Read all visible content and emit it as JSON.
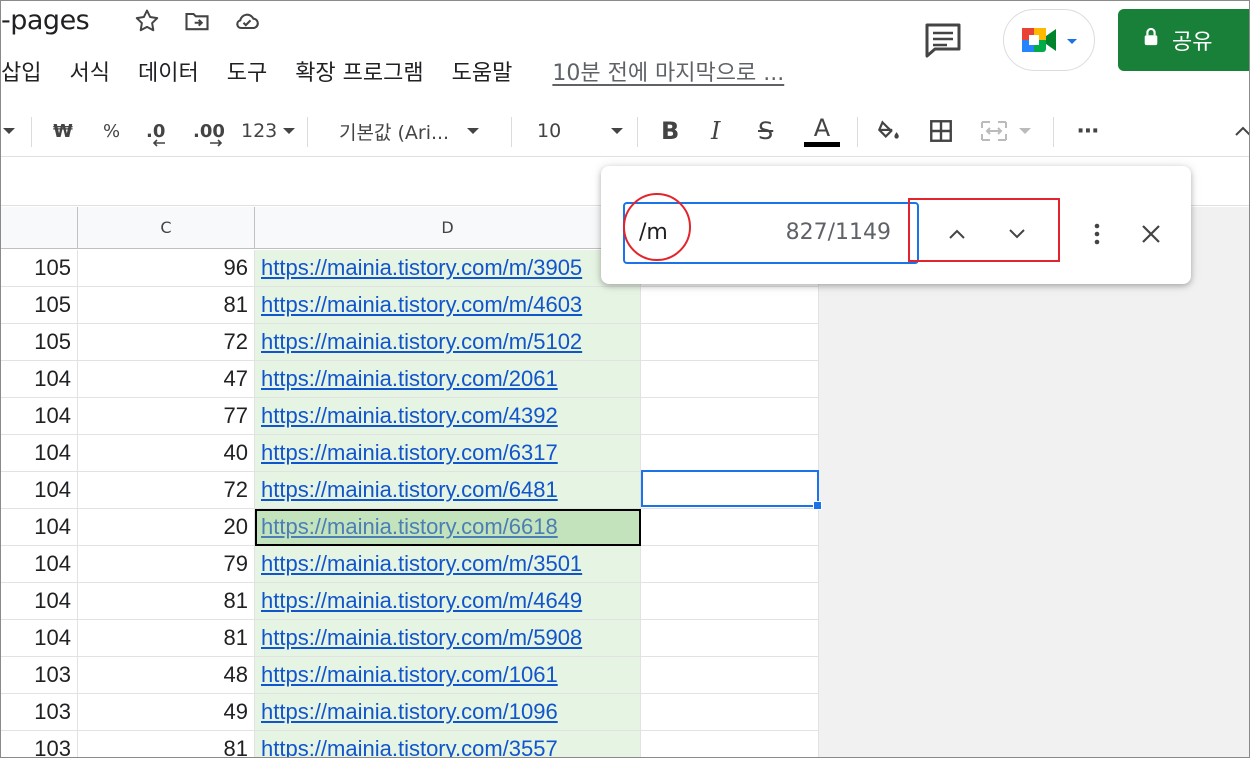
{
  "title": {
    "doc_name": "-pages"
  },
  "menu": {
    "items": [
      "삽입",
      "서식",
      "데이터",
      "도구",
      "확장 프로그램",
      "도움말"
    ],
    "last_edit": "10분 전에 마지막으로 ..."
  },
  "share": {
    "label": "공유"
  },
  "toolbar": {
    "currency": "₩",
    "percent": "%",
    "decrease_decimal": ".0",
    "increase_decimal": ".00",
    "number_format": "123",
    "font": "기본값 (Ari...",
    "font_size": "10",
    "bold": "B",
    "italic": "I",
    "strike": "S",
    "text_color": "A",
    "more": "⋯"
  },
  "columns": {
    "c": "C",
    "d": "D"
  },
  "rows": [
    {
      "b": "105",
      "c": "96",
      "d": "https://mainia.tistory.com/m/3905"
    },
    {
      "b": "105",
      "c": "81",
      "d": "https://mainia.tistory.com/m/4603"
    },
    {
      "b": "105",
      "c": "72",
      "d": "https://mainia.tistory.com/m/5102"
    },
    {
      "b": "104",
      "c": "47",
      "d": "https://mainia.tistory.com/2061"
    },
    {
      "b": "104",
      "c": "77",
      "d": "https://mainia.tistory.com/4392"
    },
    {
      "b": "104",
      "c": "40",
      "d": "https://mainia.tistory.com/6317"
    },
    {
      "b": "104",
      "c": "72",
      "d": "https://mainia.tistory.com/6481"
    },
    {
      "b": "104",
      "c": "20",
      "d": "https://mainia.tistory.com/6618"
    },
    {
      "b": "104",
      "c": "79",
      "d": "https://mainia.tistory.com/m/3501"
    },
    {
      "b": "104",
      "c": "81",
      "d": "https://mainia.tistory.com/m/4649"
    },
    {
      "b": "104",
      "c": "81",
      "d": "https://mainia.tistory.com/m/5908"
    },
    {
      "b": "103",
      "c": "48",
      "d": "https://mainia.tistory.com/1061"
    },
    {
      "b": "103",
      "c": "49",
      "d": "https://mainia.tistory.com/1096"
    },
    {
      "b": "103",
      "c": "81",
      "d": "https://mainia.tistory.com/3557"
    }
  ],
  "find": {
    "query": "/m",
    "count": "827/1149"
  },
  "colors": {
    "accent": "#1a73e8",
    "share_green": "#188038",
    "link_bg": "#e6f4e3",
    "annotation_red": "#e2252c"
  }
}
